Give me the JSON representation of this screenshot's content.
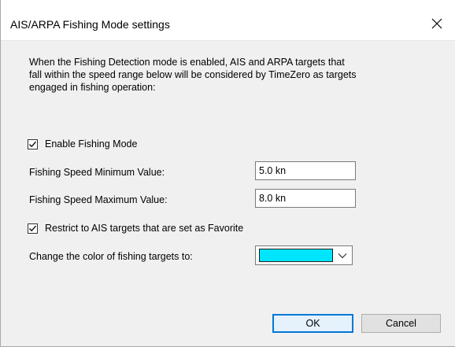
{
  "window": {
    "title": "AIS/ARPA Fishing Mode settings",
    "close_icon": "close-icon"
  },
  "description": {
    "line1": "When the Fishing Detection mode is enabled, AIS and ARPA targets that",
    "line2": "fall within the speed range below will be considered by TimeZero as targets",
    "line3": "engaged in fishing operation:"
  },
  "enable_fishing_mode": {
    "label": "Enable Fishing Mode",
    "checked": true
  },
  "min_speed": {
    "label": "Fishing Speed Minimum Value:",
    "value": "5.0 kn"
  },
  "max_speed": {
    "label": "Fishing Speed Maximum Value:",
    "value": "8.0 kn"
  },
  "restrict_favorite": {
    "label": "Restrict to AIS targets that are set as Favorite",
    "checked": true
  },
  "fishing_color": {
    "label": "Change the color of fishing targets to:",
    "color": "#00e5ff",
    "arrow_icon": "chevron-down-icon"
  },
  "buttons": {
    "ok": "OK",
    "cancel": "Cancel"
  },
  "colors": {
    "accent": "#0078d7",
    "dialog_bg": "#f0f0f0"
  }
}
